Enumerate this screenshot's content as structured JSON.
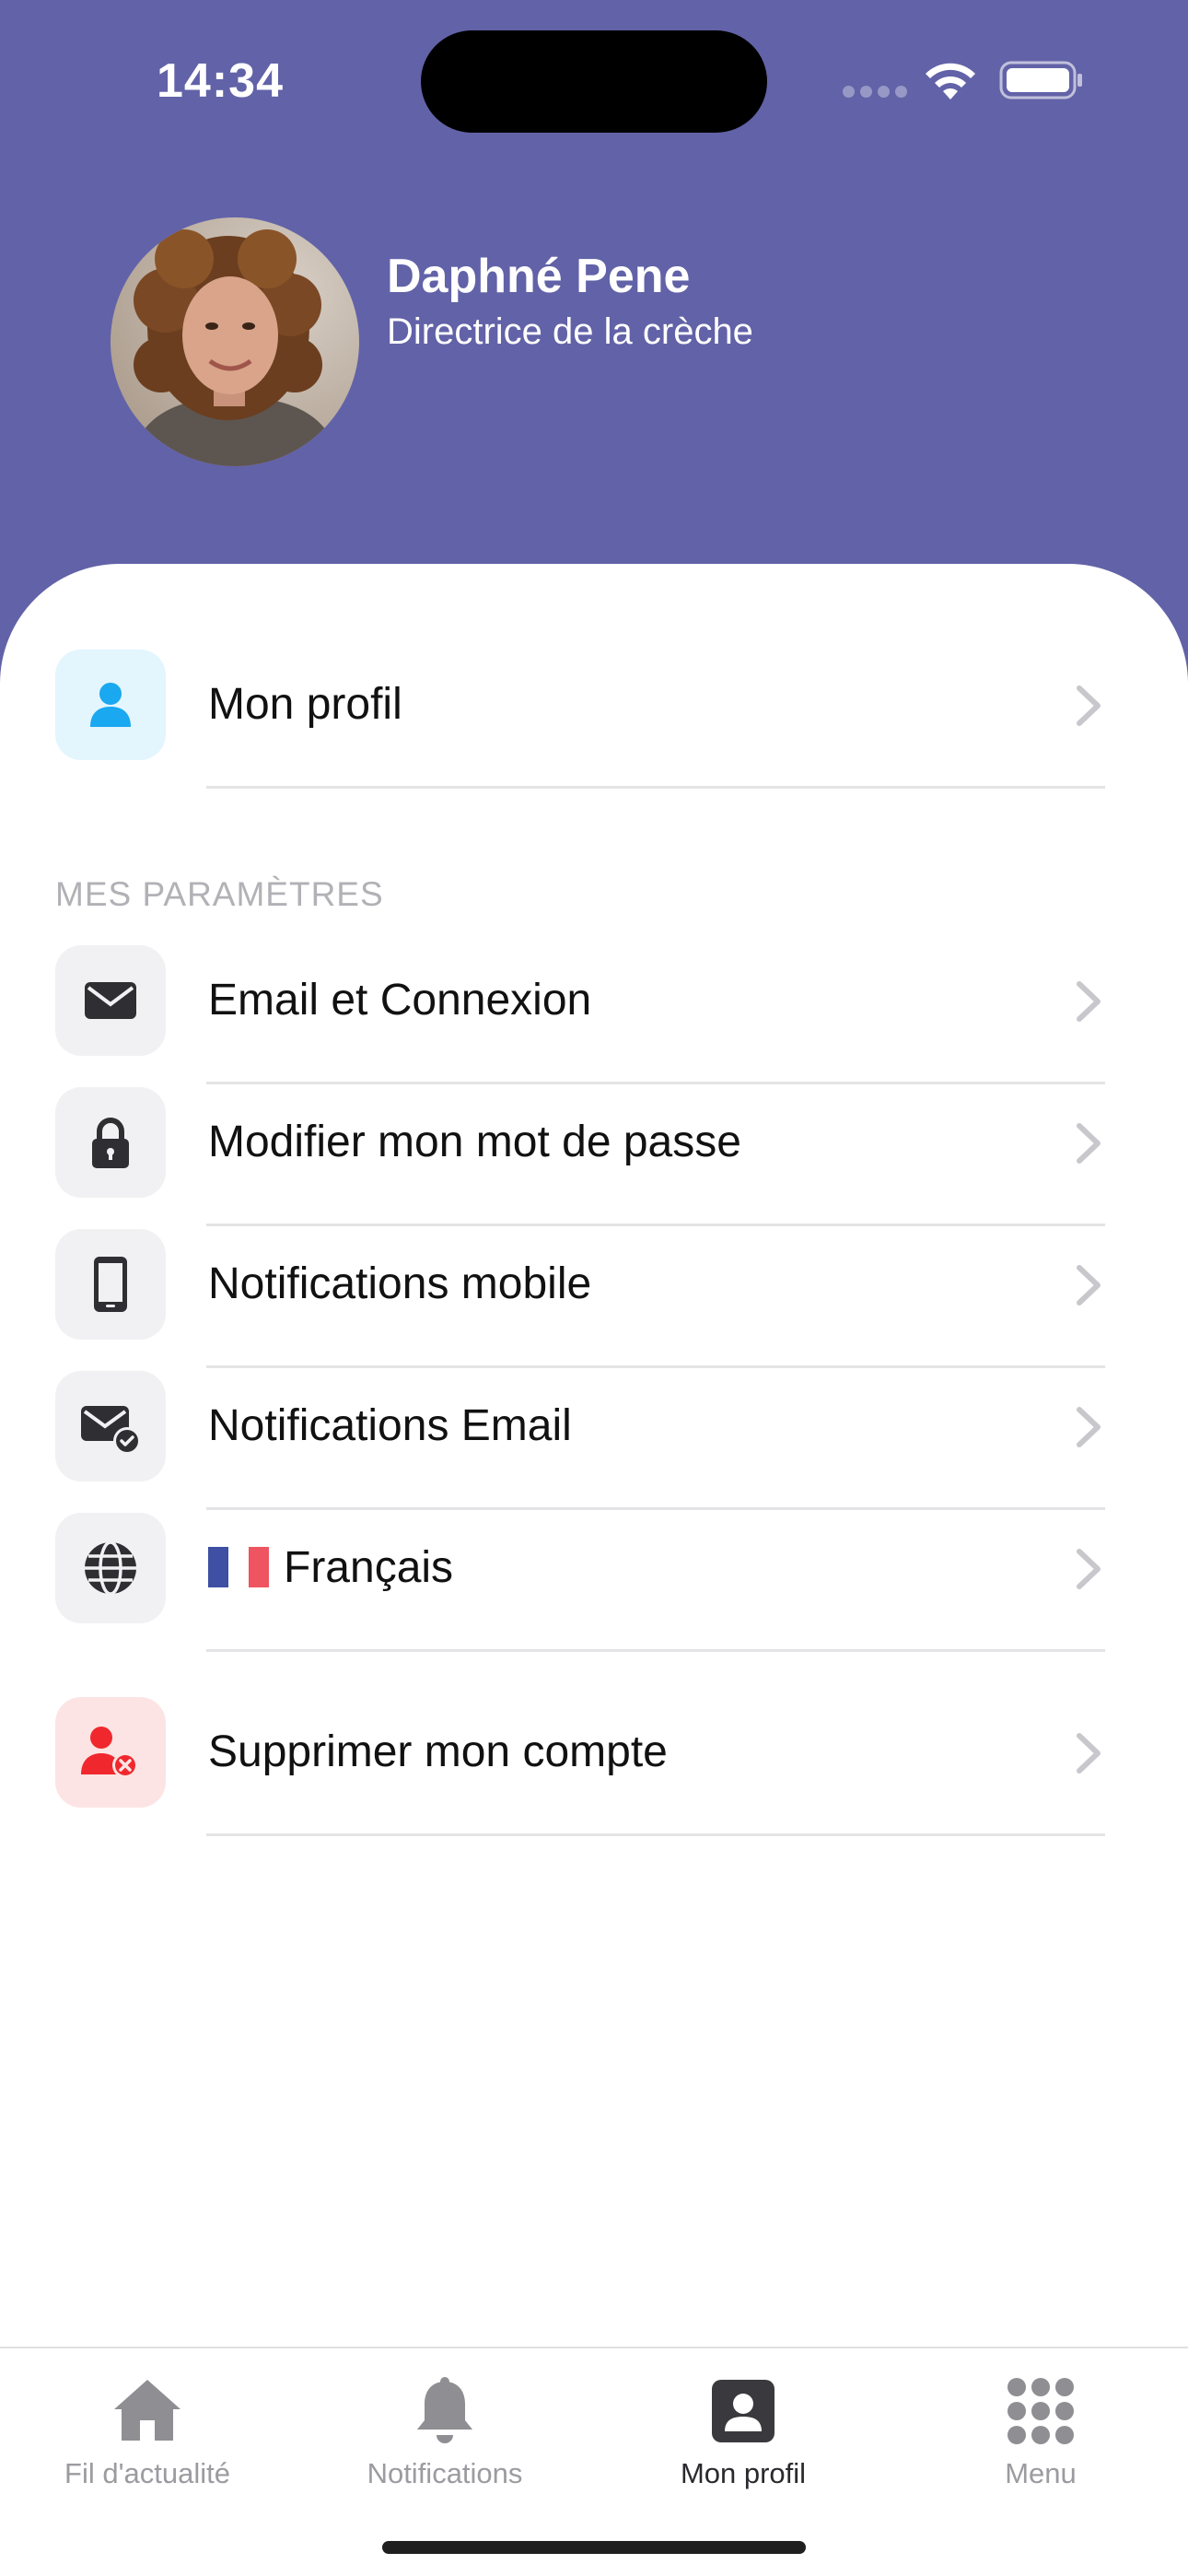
{
  "status_bar": {
    "time": "14:34",
    "icons": [
      "signal-dots-icon",
      "wifi-icon",
      "battery-icon"
    ]
  },
  "profile": {
    "name": "Daphné Pene",
    "role": "Directrice de la crèche",
    "avatar_icon": "avatar-photo"
  },
  "menu": {
    "profile_item": {
      "label": "Mon profil",
      "icon": "user-icon",
      "icon_color": "#1aa8f0",
      "icon_bg": "#e3f5fd"
    },
    "section_title": "MES PARAMÈTRES",
    "settings": [
      {
        "label": "Email et Connexion",
        "icon": "envelope-icon"
      },
      {
        "label": "Modifier mon mot de passe",
        "icon": "lock-icon"
      },
      {
        "label": "Notifications mobile",
        "icon": "phone-icon"
      },
      {
        "label": "Notifications Email",
        "icon": "envelope-check-icon"
      },
      {
        "label": "Français",
        "icon": "globe-icon",
        "flag": "french-flag-icon"
      }
    ],
    "delete_item": {
      "label": "Supprimer mon compte",
      "icon": "user-remove-icon",
      "icon_color": "#f0282d",
      "icon_bg": "#fde4e4"
    }
  },
  "tabbar": {
    "tabs": [
      {
        "label": "Fil d'actualité",
        "icon": "home-icon",
        "active": false
      },
      {
        "label": "Notifications",
        "icon": "bell-icon",
        "active": false
      },
      {
        "label": "Mon profil",
        "icon": "profile-card-icon",
        "active": true
      },
      {
        "label": "Menu",
        "icon": "grid-icon",
        "active": false
      }
    ]
  },
  "colors": {
    "header_bg": "#6262a8",
    "icon_dark": "#2f2f33",
    "chevron": "#c7c7cc",
    "flag_blue": "#3f4fa3",
    "flag_red": "#ee5560"
  }
}
